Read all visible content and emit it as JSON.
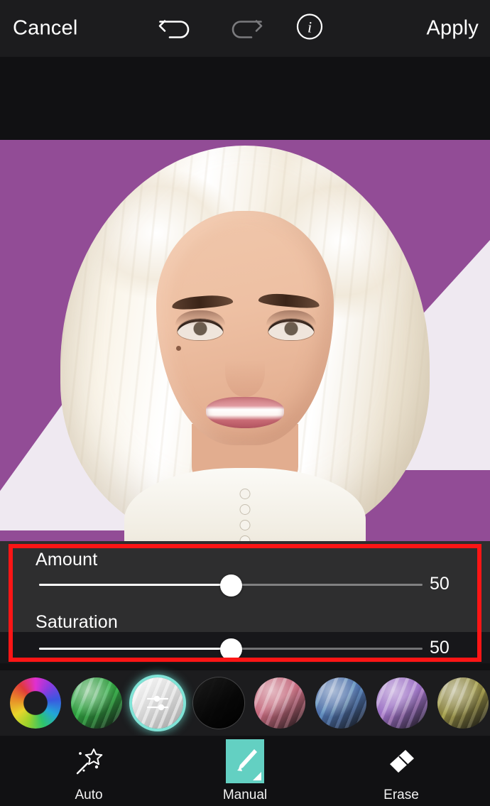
{
  "app": {
    "screen_name": "Hair Color Editor"
  },
  "topbar": {
    "cancel_label": "Cancel",
    "apply_label": "Apply",
    "undo_icon": "undo-arrow-icon",
    "redo_icon": "redo-arrow-icon",
    "info_icon": "info-circle-icon",
    "undo_enabled": "true",
    "redo_enabled": "false"
  },
  "sliders": [
    {
      "label": "Amount",
      "value": "50",
      "min": 0,
      "max": 100,
      "percent": 50
    },
    {
      "label": "Saturation",
      "value": "50",
      "min": 0,
      "max": 100,
      "percent": 50
    }
  ],
  "annotation": {
    "shape": "rectangle",
    "color": "#fc1515",
    "highlights": "slider-panel"
  },
  "swatches": [
    {
      "name": "color-wheel",
      "label": "Color Wheel",
      "color": "#e030d0",
      "selected": "false"
    },
    {
      "name": "green",
      "label": "Green",
      "color": "#2f9b3e",
      "selected": "false"
    },
    {
      "name": "silver",
      "label": "Silver",
      "color": "#d8d8d8",
      "selected": "true"
    },
    {
      "name": "black",
      "label": "Black",
      "color": "#0a0a0a",
      "selected": "false"
    },
    {
      "name": "pink",
      "label": "Pink",
      "color": "#c4697c",
      "selected": "false"
    },
    {
      "name": "blue",
      "label": "Blue",
      "color": "#4c6fa8",
      "selected": "false"
    },
    {
      "name": "purple",
      "label": "Purple",
      "color": "#9b6fc4",
      "selected": "false"
    },
    {
      "name": "olive",
      "label": "Olive",
      "color": "#8a8340",
      "selected": "false"
    }
  ],
  "tools": [
    {
      "name": "auto",
      "label": "Auto",
      "icon": "magic-wand-icon",
      "selected": "false"
    },
    {
      "name": "manual",
      "label": "Manual",
      "icon": "paintbrush-icon",
      "selected": "true"
    },
    {
      "name": "erase",
      "label": "Erase",
      "icon": "eraser-icon",
      "selected": "false"
    }
  ],
  "theme": {
    "accent": "#63d0c2",
    "topbar_bg": "#1c1c1e",
    "panel_bg": "#111113",
    "text": "#ffffff"
  },
  "photo": {
    "description": "Portrait of a woman with platinum blonde hair against a purple backdrop with white triangles",
    "background_color": "#924c96",
    "accent_shape_color": "#efe9f1"
  }
}
